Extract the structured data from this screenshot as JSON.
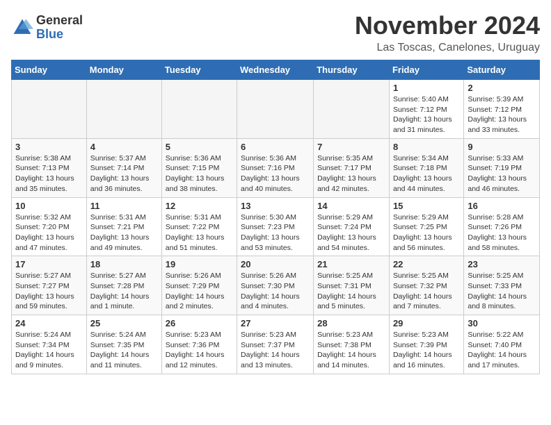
{
  "header": {
    "logo": {
      "general": "General",
      "blue": "Blue"
    },
    "title": "November 2024",
    "location": "Las Toscas, Canelones, Uruguay"
  },
  "weekdays": [
    "Sunday",
    "Monday",
    "Tuesday",
    "Wednesday",
    "Thursday",
    "Friday",
    "Saturday"
  ],
  "weeks": [
    [
      {
        "day": "",
        "empty": true
      },
      {
        "day": "",
        "empty": true
      },
      {
        "day": "",
        "empty": true
      },
      {
        "day": "",
        "empty": true
      },
      {
        "day": "",
        "empty": true
      },
      {
        "day": "1",
        "sunrise": "5:40 AM",
        "sunset": "7:12 PM",
        "daylight": "13 hours and 31 minutes."
      },
      {
        "day": "2",
        "sunrise": "5:39 AM",
        "sunset": "7:12 PM",
        "daylight": "13 hours and 33 minutes."
      }
    ],
    [
      {
        "day": "3",
        "sunrise": "5:38 AM",
        "sunset": "7:13 PM",
        "daylight": "13 hours and 35 minutes."
      },
      {
        "day": "4",
        "sunrise": "5:37 AM",
        "sunset": "7:14 PM",
        "daylight": "13 hours and 36 minutes."
      },
      {
        "day": "5",
        "sunrise": "5:36 AM",
        "sunset": "7:15 PM",
        "daylight": "13 hours and 38 minutes."
      },
      {
        "day": "6",
        "sunrise": "5:36 AM",
        "sunset": "7:16 PM",
        "daylight": "13 hours and 40 minutes."
      },
      {
        "day": "7",
        "sunrise": "5:35 AM",
        "sunset": "7:17 PM",
        "daylight": "13 hours and 42 minutes."
      },
      {
        "day": "8",
        "sunrise": "5:34 AM",
        "sunset": "7:18 PM",
        "daylight": "13 hours and 44 minutes."
      },
      {
        "day": "9",
        "sunrise": "5:33 AM",
        "sunset": "7:19 PM",
        "daylight": "13 hours and 46 minutes."
      }
    ],
    [
      {
        "day": "10",
        "sunrise": "5:32 AM",
        "sunset": "7:20 PM",
        "daylight": "13 hours and 47 minutes."
      },
      {
        "day": "11",
        "sunrise": "5:31 AM",
        "sunset": "7:21 PM",
        "daylight": "13 hours and 49 minutes."
      },
      {
        "day": "12",
        "sunrise": "5:31 AM",
        "sunset": "7:22 PM",
        "daylight": "13 hours and 51 minutes."
      },
      {
        "day": "13",
        "sunrise": "5:30 AM",
        "sunset": "7:23 PM",
        "daylight": "13 hours and 53 minutes."
      },
      {
        "day": "14",
        "sunrise": "5:29 AM",
        "sunset": "7:24 PM",
        "daylight": "13 hours and 54 minutes."
      },
      {
        "day": "15",
        "sunrise": "5:29 AM",
        "sunset": "7:25 PM",
        "daylight": "13 hours and 56 minutes."
      },
      {
        "day": "16",
        "sunrise": "5:28 AM",
        "sunset": "7:26 PM",
        "daylight": "13 hours and 58 minutes."
      }
    ],
    [
      {
        "day": "17",
        "sunrise": "5:27 AM",
        "sunset": "7:27 PM",
        "daylight": "13 hours and 59 minutes."
      },
      {
        "day": "18",
        "sunrise": "5:27 AM",
        "sunset": "7:28 PM",
        "daylight": "14 hours and 1 minute."
      },
      {
        "day": "19",
        "sunrise": "5:26 AM",
        "sunset": "7:29 PM",
        "daylight": "14 hours and 2 minutes."
      },
      {
        "day": "20",
        "sunrise": "5:26 AM",
        "sunset": "7:30 PM",
        "daylight": "14 hours and 4 minutes."
      },
      {
        "day": "21",
        "sunrise": "5:25 AM",
        "sunset": "7:31 PM",
        "daylight": "14 hours and 5 minutes."
      },
      {
        "day": "22",
        "sunrise": "5:25 AM",
        "sunset": "7:32 PM",
        "daylight": "14 hours and 7 minutes."
      },
      {
        "day": "23",
        "sunrise": "5:25 AM",
        "sunset": "7:33 PM",
        "daylight": "14 hours and 8 minutes."
      }
    ],
    [
      {
        "day": "24",
        "sunrise": "5:24 AM",
        "sunset": "7:34 PM",
        "daylight": "14 hours and 9 minutes."
      },
      {
        "day": "25",
        "sunrise": "5:24 AM",
        "sunset": "7:35 PM",
        "daylight": "14 hours and 11 minutes."
      },
      {
        "day": "26",
        "sunrise": "5:23 AM",
        "sunset": "7:36 PM",
        "daylight": "14 hours and 12 minutes."
      },
      {
        "day": "27",
        "sunrise": "5:23 AM",
        "sunset": "7:37 PM",
        "daylight": "14 hours and 13 minutes."
      },
      {
        "day": "28",
        "sunrise": "5:23 AM",
        "sunset": "7:38 PM",
        "daylight": "14 hours and 14 minutes."
      },
      {
        "day": "29",
        "sunrise": "5:23 AM",
        "sunset": "7:39 PM",
        "daylight": "14 hours and 16 minutes."
      },
      {
        "day": "30",
        "sunrise": "5:22 AM",
        "sunset": "7:40 PM",
        "daylight": "14 hours and 17 minutes."
      }
    ]
  ],
  "labels": {
    "sunrise": "Sunrise:",
    "sunset": "Sunset:",
    "daylight": "Daylight hours"
  }
}
